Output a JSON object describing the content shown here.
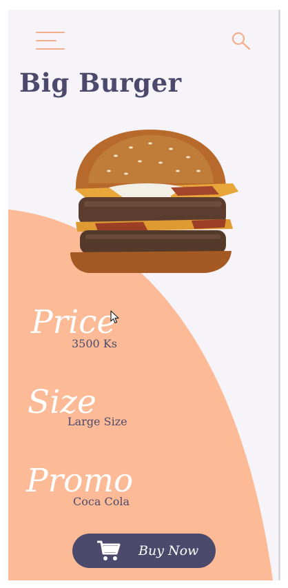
{
  "app": {
    "title": "Big Burger",
    "accent_color": "#f9b48f",
    "text_color": "#4b4a6d",
    "background_color": "#f6f4f8"
  },
  "header": {
    "menu_icon": "hamburger-menu-icon",
    "search_icon": "search-icon"
  },
  "product": {
    "image": "burger-image",
    "details": [
      {
        "label": "Price",
        "value": "3500 Ks"
      },
      {
        "label": "Size",
        "value": "Large Size"
      },
      {
        "label": "Promo",
        "value": "Coca Cola"
      }
    ]
  },
  "cta": {
    "icon": "cart-icon",
    "label": "Buy Now"
  }
}
